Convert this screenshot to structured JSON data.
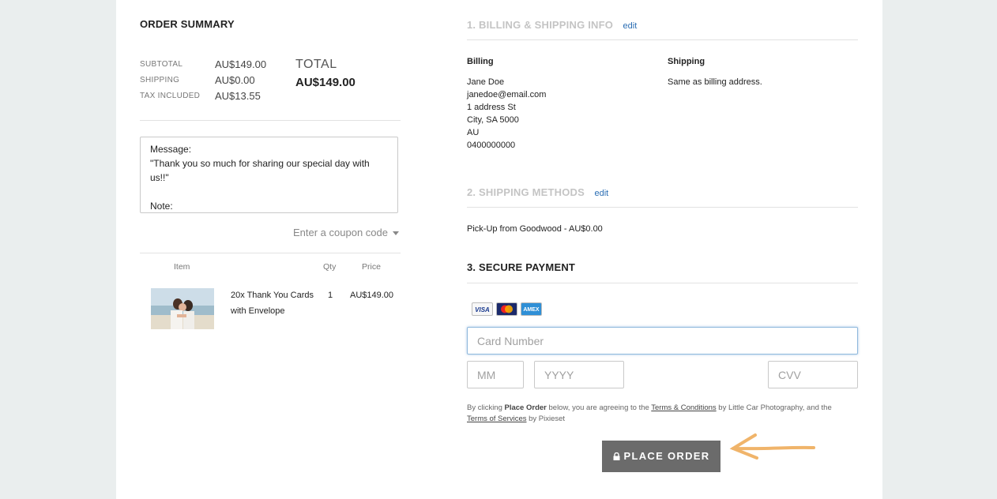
{
  "order_summary": {
    "title": "ORDER SUMMARY",
    "rows": [
      {
        "label": "SUBTOTAL",
        "value": "AU$149.00"
      },
      {
        "label": "SHIPPING",
        "value": "AU$0.00"
      },
      {
        "label": "TAX INCLUDED",
        "value": "AU$13.55"
      }
    ],
    "total_label": "TOTAL",
    "total_value": "AU$149.00",
    "message": "Message:\n\"Thank you so much for sharing our special day with us!!\"\n\nNote:\nPlease include \"Thank You\" overlay on photo.",
    "coupon_link": "Enter a coupon code",
    "table": {
      "headers": {
        "item": "Item",
        "qty": "Qty",
        "price": "Price"
      },
      "rows": [
        {
          "name": "20x Thank You Cards with Envelope",
          "qty": "1",
          "price": "AU$149.00"
        }
      ]
    }
  },
  "billing_shipping": {
    "heading": "1. BILLING & SHIPPING INFO",
    "edit": "edit",
    "billing_label": "Billing",
    "billing_lines": [
      "Jane Doe",
      "janedoe@email.com",
      "1 address St",
      "City, SA 5000",
      "AU",
      "0400000000"
    ],
    "shipping_label": "Shipping",
    "shipping_text": "Same as billing address."
  },
  "shipping_methods": {
    "heading": "2. SHIPPING METHODS",
    "edit": "edit",
    "selected": "Pick-Up from Goodwood - AU$0.00"
  },
  "payment": {
    "heading": "3. SECURE PAYMENT",
    "cards": [
      "VISA",
      "MasterCard",
      "AMEX"
    ],
    "card_number_placeholder": "Card Number",
    "mm_placeholder": "MM",
    "yyyy_placeholder": "YYYY",
    "cvv_placeholder": "CVV",
    "terms": {
      "t1": "By clicking ",
      "t2": "Place Order",
      "t3": " below, you are agreeing to the ",
      "t4": "Terms & Conditions",
      "t5": " by Little Car Photography, and the",
      "t6": "Terms of Services",
      "t7": " by Pixieset"
    },
    "place_order": "PLACE ORDER"
  }
}
